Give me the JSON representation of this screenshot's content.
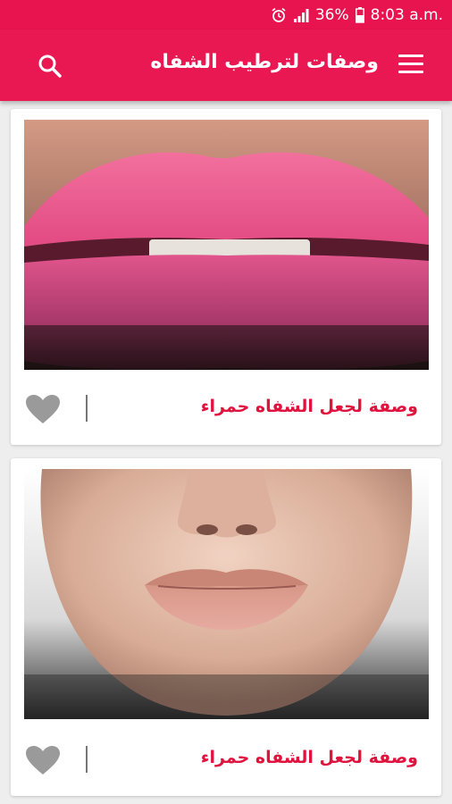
{
  "status_bar": {
    "alarm_icon": "alarm-clock-icon",
    "signal_icon": "signal-bars-icon",
    "battery_percent": "36%",
    "battery_icon": "battery-icon",
    "time": "8:03 a.m."
  },
  "app_bar": {
    "title": "وصفات لترطيب الشفاه",
    "menu_icon": "hamburger-menu-icon",
    "search_icon": "search-icon",
    "color": "#ea1852"
  },
  "cards": [
    {
      "title": "وصفة لجعل الشفاه حمراء",
      "image": "pink-lips-photo",
      "favorite_icon": "heart-icon"
    },
    {
      "title": "وصفة لجعل الشفاه حمراء",
      "image": "natural-lips-face-photo",
      "favorite_icon": "heart-icon"
    }
  ],
  "colors": {
    "accent": "#e0133f",
    "heart": "#9a9a9a"
  }
}
